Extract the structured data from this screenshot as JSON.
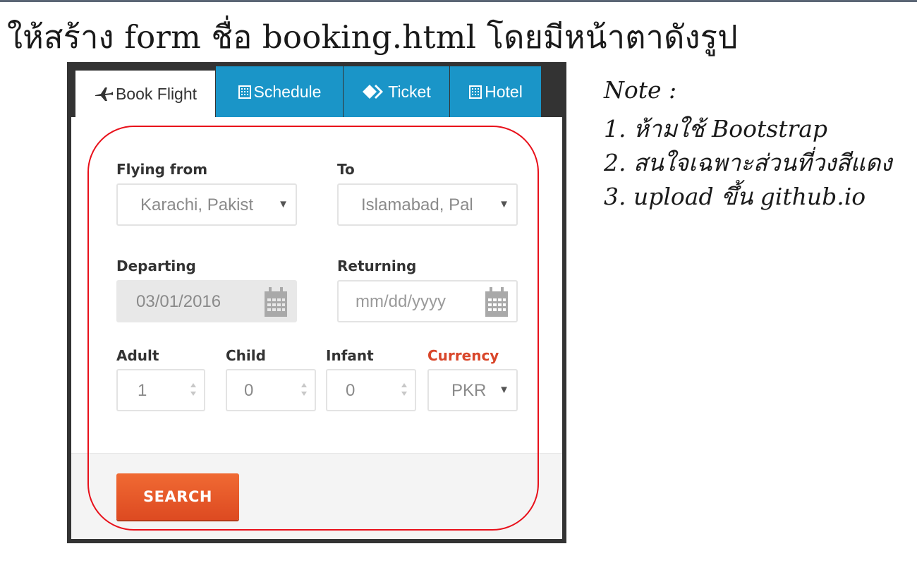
{
  "slide": {
    "title": "ให้สร้าง form ชื่อ booking.html โดยมีหน้าตาดังรูป"
  },
  "notes": {
    "heading": "Note :",
    "items": [
      "1. ห้ามใช้ Bootstrap",
      "2. สนใจเฉพาะส่วนที่วงสีแดง",
      "3. upload ขึ้น github.io"
    ]
  },
  "tabs": [
    {
      "label": "Book Flight",
      "icon": "airplane-icon",
      "active": true
    },
    {
      "label": "Schedule",
      "icon": "building-icon",
      "active": false
    },
    {
      "label": "Ticket",
      "icon": "ticket-icon",
      "active": false
    },
    {
      "label": "Hotel",
      "icon": "building-icon",
      "active": false
    }
  ],
  "form": {
    "flying_from": {
      "label": "Flying from",
      "value": "Karachi, Pakist"
    },
    "to": {
      "label": "To",
      "value": "Islamabad, Pal"
    },
    "departing": {
      "label": "Departing",
      "value": "03/01/2016"
    },
    "returning": {
      "label": "Returning",
      "placeholder": "mm/dd/yyyy"
    },
    "adult": {
      "label": "Adult",
      "value": "1"
    },
    "child": {
      "label": "Child",
      "value": "0"
    },
    "infant": {
      "label": "Infant",
      "value": "0"
    },
    "currency": {
      "label": "Currency",
      "value": "PKR"
    },
    "search_label": "SEARCH"
  },
  "colors": {
    "tab_blue": "#1a95c8",
    "frame": "#333333",
    "button_orange": "#e8572a",
    "currency_label": "#d9462a",
    "highlight_red": "#e8101a"
  }
}
